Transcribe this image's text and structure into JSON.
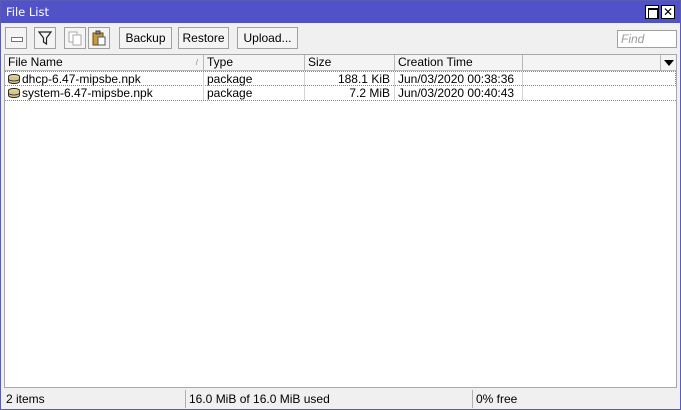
{
  "window": {
    "title": "File List"
  },
  "toolbar": {
    "backup_label": "Backup",
    "restore_label": "Restore",
    "upload_label": "Upload...",
    "find_placeholder": "Find"
  },
  "table": {
    "columns": [
      "File Name",
      "Type",
      "Size",
      "Creation Time"
    ],
    "rows": [
      {
        "name": "dhcp-6.47-mipsbe.npk",
        "type": "package",
        "size": "188.1 KiB",
        "created": "Jun/03/2020 00:38:36"
      },
      {
        "name": "system-6.47-mipsbe.npk",
        "type": "package",
        "size": "7.2 MiB",
        "created": "Jun/03/2020 00:40:43"
      }
    ]
  },
  "status": {
    "items": "2 items",
    "used": "16.0 MiB of 16.0 MiB used",
    "free": "0% free"
  },
  "colors": {
    "titlebar": "#5151c8",
    "window_bg": "#f0f0f0"
  },
  "icons": [
    "minus-icon",
    "filter-icon",
    "copy-icon",
    "paste-icon",
    "maximize-icon",
    "close-icon",
    "package-file-icon",
    "column-menu-icon"
  ]
}
